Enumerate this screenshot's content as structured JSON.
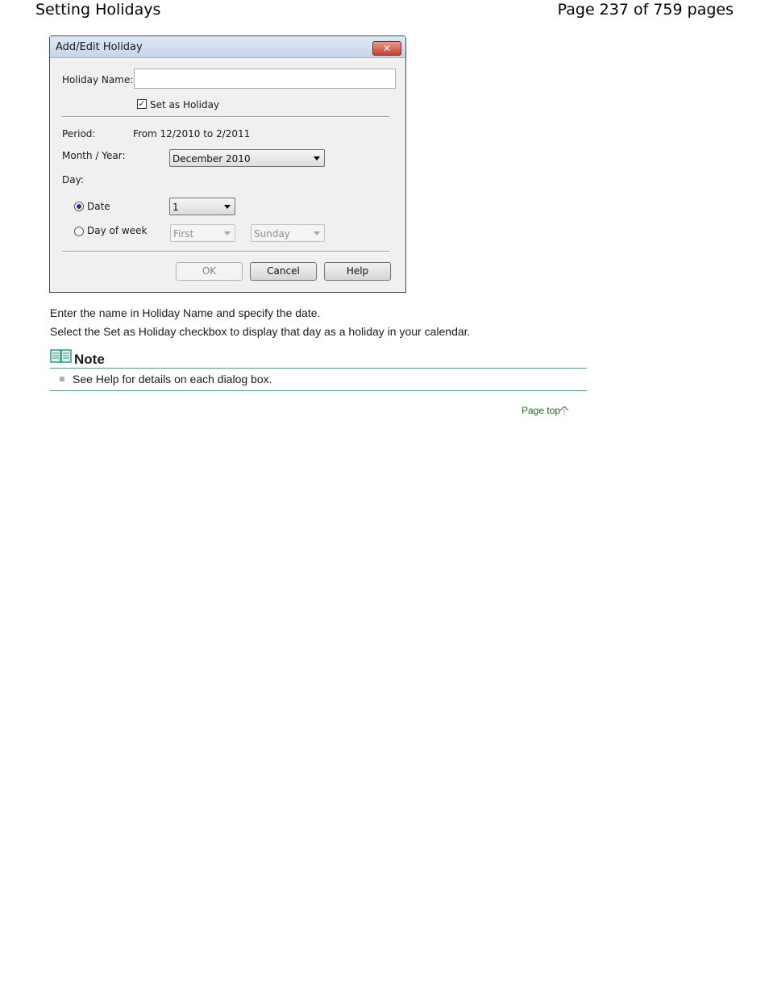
{
  "page": {
    "title": "Setting Holidays",
    "page_info": "Page 237 of 759 pages"
  },
  "dialog": {
    "title": "Add/Edit Holiday",
    "close_label": "✕",
    "holiday_name_label": "Holiday Name:",
    "holiday_name_value": "",
    "set_as_holiday_label": "Set as Holiday",
    "set_as_holiday_checked": true,
    "period_label": "Period:",
    "period_value": "From 12/2010 to 2/2011",
    "month_year_label": "Month / Year:",
    "month_year_value": "December 2010",
    "day_label": "Day:",
    "date_radio_label": "Date",
    "date_radio_selected": true,
    "date_value": "1",
    "day_of_week_radio_label": "Day of week",
    "day_of_week_radio_selected": false,
    "week_ordinal_value": "First",
    "weekday_value": "Sunday",
    "ok_label": "OK",
    "cancel_label": "Cancel",
    "help_label": "Help"
  },
  "body": {
    "paragraph_1": "Enter the name in Holiday Name and specify the date.",
    "paragraph_2": "Select the Set as Holiday checkbox to display that day as a holiday in your calendar."
  },
  "note": {
    "title": "Note",
    "items": [
      "See Help for details on each dialog box."
    ]
  },
  "footer": {
    "page_top_label": "Page top"
  },
  "icons": {
    "note": "book-icon",
    "page_top": "arrow-up-icon"
  },
  "colors": {
    "link": "#1d6a1a",
    "rule": "#4a9a82"
  }
}
